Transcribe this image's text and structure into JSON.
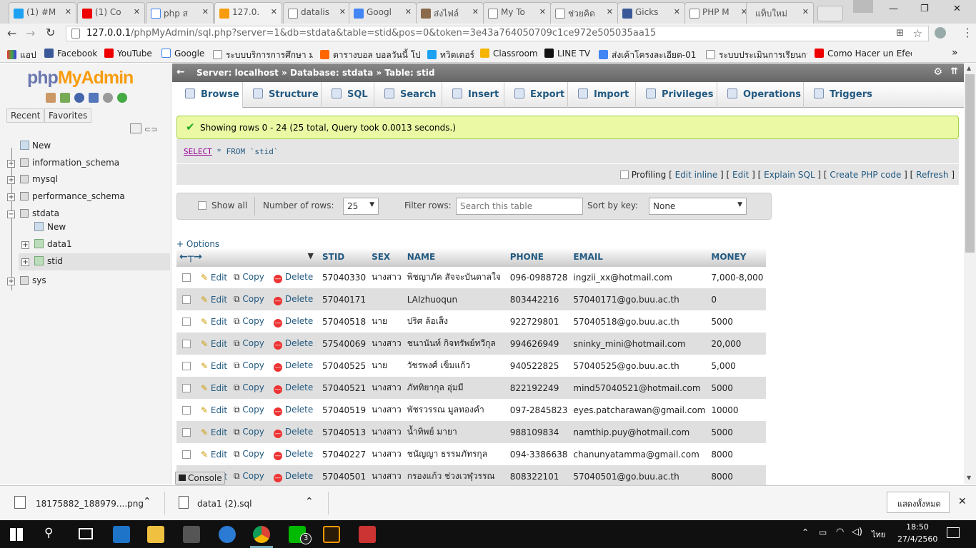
{
  "browser": {
    "tabs": [
      "(1) #M",
      "(1) Co",
      "php ส",
      "127.0.",
      "datalis",
      "Googl",
      "ส่งไฟล์",
      "My To",
      "ช่วยคิด",
      "Gicks",
      "PHP M",
      "แท็บใหม่"
    ],
    "url_host": "127.0.0.1",
    "url_rest": "/phpMyAdmin/sql.php?server=1&db=stdata&table=stid&pos=0&token=3e43a764050709c1ce972e505035aa15",
    "bookmarks": [
      "แอป",
      "Facebook",
      "YouTube",
      "Google",
      "ระบบบริการการศึกษา มห",
      "ตารางบอล บอลวันนี้ โปรแ",
      "ทวิตเตอร์",
      "Classroom",
      "LINE TV",
      "ส่งเค้าโครงละเอียด-01 - 4",
      "ระบบประเมินการเรียนการส",
      "Como Hacer un Efecto"
    ]
  },
  "sidebar": {
    "logo_php": "php",
    "logo_admin": "MyAdmin",
    "recent": "Recent",
    "favorites": "Favorites",
    "tree": [
      "New",
      "information_schema",
      "mysql",
      "performance_schema",
      "stdata",
      "New",
      "data1",
      "stid",
      "sys"
    ]
  },
  "main": {
    "crumb_server": "Server: localhost",
    "crumb_db": "Database: stdata",
    "crumb_table": "Table: stid",
    "tabs": [
      "Browse",
      "Structure",
      "SQL",
      "Search",
      "Insert",
      "Export",
      "Import",
      "Privileges",
      "Operations",
      "Triggers"
    ],
    "success": "Showing rows 0 - 24 (25 total, Query took 0.0013 seconds.)",
    "sql_kw": "SELECT",
    "sql_rest": " * FROM `stid`",
    "profiling": "Profiling",
    "links": [
      "Edit inline",
      "Edit",
      "Explain SQL",
      "Create PHP code",
      "Refresh"
    ],
    "show_all": "Show all",
    "rows_label": "Number of rows:",
    "rows_value": "25",
    "filter_label": "Filter rows:",
    "filter_placeholder": "Search this table",
    "sort_label": "Sort by key:",
    "sort_value": "None",
    "options": "+ Options",
    "columns": [
      "STID",
      "SEX",
      "NAME",
      "PHONE",
      "EMAIL",
      "MONEY"
    ],
    "actions": [
      "Edit",
      "Copy",
      "Delete"
    ],
    "rows": [
      [
        "57040330",
        "นางสาว",
        "พิชญาภัค สัจจะบันดาลใจ",
        "096-0988728",
        "ingzii_xx@hotmail.com",
        "7,000-8,000"
      ],
      [
        "57040171",
        "",
        "LAIzhuoqun",
        "803442216",
        "57040171@go.buu.ac.th",
        "0"
      ],
      [
        "57040518",
        "นาย",
        "ปริศ ล้อเส็ง",
        "922729801",
        "57040518@go.buu.ac.th",
        "5000"
      ],
      [
        "57540069",
        "นางสาว",
        "ชนานันท์  กิจทรัพย์ทวีกุล",
        "994626949",
        "sninky_mini@hotmail.com",
        "20,000"
      ],
      [
        "57040525",
        "นาย",
        "วัชรพงศ์ เข็มแก้ว",
        "940522825",
        "57040525@go.buu.ac.th",
        "5,000"
      ],
      [
        "57040521",
        "นางสาว",
        "ภัททิยากุล  อุ่มมี",
        "822192249",
        "mind57040521@hotmail.com",
        "5000"
      ],
      [
        "57040519",
        "นางสาว",
        "พัชรวรรณ มูลทองคำ",
        "097-2845823",
        "eyes.patcharawan@gmail.com",
        "10000"
      ],
      [
        "57040513",
        "นางสาว",
        "น้ำทิพย์  มายา",
        "988109834",
        "namthip.puy@hotmail.com",
        "5000"
      ],
      [
        "57040227",
        "นางสาว",
        "ชนัญญา ธรรมภัทรกุล",
        "094-3386638",
        "chanunyatamma@gmail.com",
        "8000"
      ],
      [
        "57040501",
        "นางสาว",
        "กรองแก้ว  ช่วงเวฬุวรรณ",
        "808322101",
        "57040501@go.buu.ac.th",
        "8000"
      ]
    ],
    "console": "Console"
  },
  "downloads": {
    "file1": "18175882_188979....png",
    "file2": "data1 (2).sql",
    "show_all": "แสดงทั้งหมด"
  },
  "taskbar": {
    "time": "18:50",
    "date": "27/4/2560",
    "lang": "ไทย",
    "line_badge": "3"
  }
}
